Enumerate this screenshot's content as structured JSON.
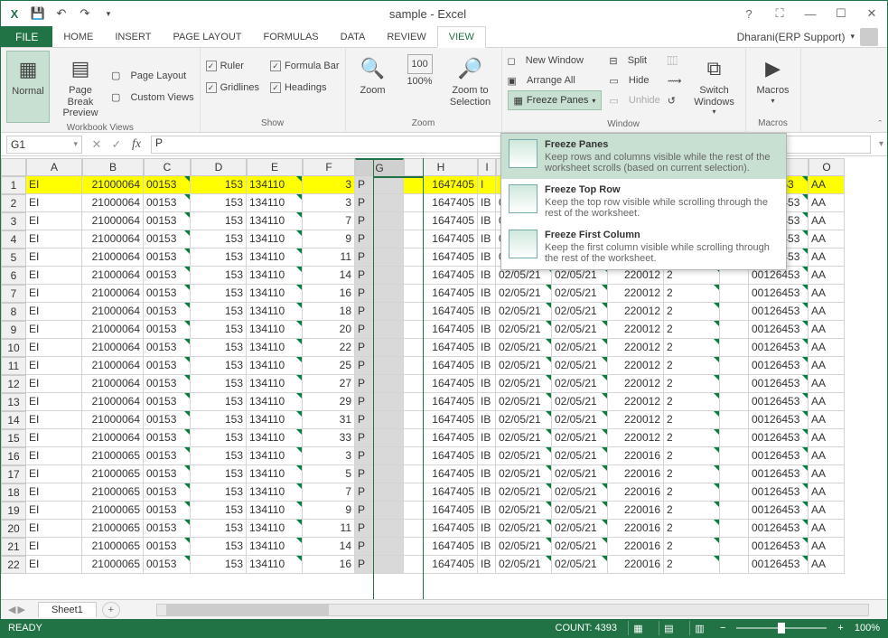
{
  "app": {
    "title": "sample - Excel"
  },
  "user": {
    "name": "Dharani(ERP Support)"
  },
  "tabs": {
    "file": "FILE",
    "items": [
      "HOME",
      "INSERT",
      "PAGE LAYOUT",
      "FORMULAS",
      "DATA",
      "REVIEW",
      "VIEW"
    ],
    "active": "VIEW"
  },
  "ribbon": {
    "workbook_views": {
      "label": "Workbook Views",
      "normal": "Normal",
      "page_break": "Page Break Preview",
      "page_layout": "Page Layout",
      "custom_views": "Custom Views"
    },
    "show": {
      "label": "Show",
      "ruler": "Ruler",
      "gridlines": "Gridlines",
      "formula_bar": "Formula Bar",
      "headings": "Headings"
    },
    "zoom": {
      "label": "Zoom",
      "zoom": "Zoom",
      "hundred": "100%",
      "to_selection": "Zoom to Selection"
    },
    "window": {
      "new_window": "New Window",
      "arrange_all": "Arrange All",
      "freeze_panes": "Freeze Panes",
      "split": "Split",
      "hide": "Hide",
      "unhide": "Unhide",
      "switch": "Switch Windows"
    },
    "macros": {
      "label": "Macros",
      "macros": "Macros"
    }
  },
  "freeze_menu": {
    "opt1": {
      "title": "Freeze Panes",
      "desc": "Keep rows and columns visible while the rest of the worksheet scrolls (based on current selection)."
    },
    "opt2": {
      "title": "Freeze Top Row",
      "desc": "Keep the top row visible while scrolling through the rest of the worksheet."
    },
    "opt3": {
      "title": "Freeze First Column",
      "desc": "Keep the first column visible while scrolling through the rest of the worksheet."
    }
  },
  "namebox": "G1",
  "formula": "P",
  "columns": [
    "A",
    "B",
    "C",
    "D",
    "E",
    "F",
    "G",
    "H",
    "I",
    "",
    "",
    "",
    "",
    "",
    "N",
    "O"
  ],
  "selected_col": "G",
  "rows": [
    {
      "r": 1,
      "hl": true,
      "a": "EI",
      "b": "21000064",
      "c": "00153",
      "d": "153",
      "e": "134110",
      "f": "3",
      "g": "P",
      "h": "1647405",
      "i": "I",
      "n": "0126453",
      "o": "AA"
    },
    {
      "r": 2,
      "a": "EI",
      "b": "21000064",
      "c": "00153",
      "d": "153",
      "e": "134110",
      "f": "3",
      "g": "P",
      "h": "1647405",
      "i": "IB",
      "j": "02/05/21",
      "k": "02/05/21",
      "l": "220012",
      "m": "2",
      "n": "00126453",
      "o": "AA"
    },
    {
      "r": 3,
      "a": "EI",
      "b": "21000064",
      "c": "00153",
      "d": "153",
      "e": "134110",
      "f": "7",
      "g": "P",
      "h": "1647405",
      "i": "IB",
      "j": "02/05/21",
      "k": "02/05/21",
      "l": "220012",
      "m": "2",
      "n": "00126453",
      "o": "AA"
    },
    {
      "r": 4,
      "a": "EI",
      "b": "21000064",
      "c": "00153",
      "d": "153",
      "e": "134110",
      "f": "9",
      "g": "P",
      "h": "1647405",
      "i": "IB",
      "j": "02/05/21",
      "k": "02/05/21",
      "l": "220012",
      "m": "2",
      "n": "00126453",
      "o": "AA"
    },
    {
      "r": 5,
      "a": "EI",
      "b": "21000064",
      "c": "00153",
      "d": "153",
      "e": "134110",
      "f": "11",
      "g": "P",
      "h": "1647405",
      "i": "IB",
      "j": "02/05/21",
      "k": "02/05/21",
      "l": "220012",
      "m": "2",
      "n": "00126453",
      "o": "AA"
    },
    {
      "r": 6,
      "a": "EI",
      "b": "21000064",
      "c": "00153",
      "d": "153",
      "e": "134110",
      "f": "14",
      "g": "P",
      "h": "1647405",
      "i": "IB",
      "j": "02/05/21",
      "k": "02/05/21",
      "l": "220012",
      "m": "2",
      "n": "00126453",
      "o": "AA"
    },
    {
      "r": 7,
      "a": "EI",
      "b": "21000064",
      "c": "00153",
      "d": "153",
      "e": "134110",
      "f": "16",
      "g": "P",
      "h": "1647405",
      "i": "IB",
      "j": "02/05/21",
      "k": "02/05/21",
      "l": "220012",
      "m": "2",
      "n": "00126453",
      "o": "AA"
    },
    {
      "r": 8,
      "a": "EI",
      "b": "21000064",
      "c": "00153",
      "d": "153",
      "e": "134110",
      "f": "18",
      "g": "P",
      "h": "1647405",
      "i": "IB",
      "j": "02/05/21",
      "k": "02/05/21",
      "l": "220012",
      "m": "2",
      "n": "00126453",
      "o": "AA"
    },
    {
      "r": 9,
      "a": "EI",
      "b": "21000064",
      "c": "00153",
      "d": "153",
      "e": "134110",
      "f": "20",
      "g": "P",
      "h": "1647405",
      "i": "IB",
      "j": "02/05/21",
      "k": "02/05/21",
      "l": "220012",
      "m": "2",
      "n": "00126453",
      "o": "AA"
    },
    {
      "r": 10,
      "a": "EI",
      "b": "21000064",
      "c": "00153",
      "d": "153",
      "e": "134110",
      "f": "22",
      "g": "P",
      "h": "1647405",
      "i": "IB",
      "j": "02/05/21",
      "k": "02/05/21",
      "l": "220012",
      "m": "2",
      "n": "00126453",
      "o": "AA"
    },
    {
      "r": 11,
      "a": "EI",
      "b": "21000064",
      "c": "00153",
      "d": "153",
      "e": "134110",
      "f": "25",
      "g": "P",
      "h": "1647405",
      "i": "IB",
      "j": "02/05/21",
      "k": "02/05/21",
      "l": "220012",
      "m": "2",
      "n": "00126453",
      "o": "AA"
    },
    {
      "r": 12,
      "a": "EI",
      "b": "21000064",
      "c": "00153",
      "d": "153",
      "e": "134110",
      "f": "27",
      "g": "P",
      "h": "1647405",
      "i": "IB",
      "j": "02/05/21",
      "k": "02/05/21",
      "l": "220012",
      "m": "2",
      "n": "00126453",
      "o": "AA"
    },
    {
      "r": 13,
      "a": "EI",
      "b": "21000064",
      "c": "00153",
      "d": "153",
      "e": "134110",
      "f": "29",
      "g": "P",
      "h": "1647405",
      "i": "IB",
      "j": "02/05/21",
      "k": "02/05/21",
      "l": "220012",
      "m": "2",
      "n": "00126453",
      "o": "AA"
    },
    {
      "r": 14,
      "a": "EI",
      "b": "21000064",
      "c": "00153",
      "d": "153",
      "e": "134110",
      "f": "31",
      "g": "P",
      "h": "1647405",
      "i": "IB",
      "j": "02/05/21",
      "k": "02/05/21",
      "l": "220012",
      "m": "2",
      "n": "00126453",
      "o": "AA"
    },
    {
      "r": 15,
      "a": "EI",
      "b": "21000064",
      "c": "00153",
      "d": "153",
      "e": "134110",
      "f": "33",
      "g": "P",
      "h": "1647405",
      "i": "IB",
      "j": "02/05/21",
      "k": "02/05/21",
      "l": "220012",
      "m": "2",
      "n": "00126453",
      "o": "AA"
    },
    {
      "r": 16,
      "a": "EI",
      "b": "21000065",
      "c": "00153",
      "d": "153",
      "e": "134110",
      "f": "3",
      "g": "P",
      "h": "1647405",
      "i": "IB",
      "j": "02/05/21",
      "k": "02/05/21",
      "l": "220016",
      "m": "2",
      "n": "00126453",
      "o": "AA"
    },
    {
      "r": 17,
      "a": "EI",
      "b": "21000065",
      "c": "00153",
      "d": "153",
      "e": "134110",
      "f": "5",
      "g": "P",
      "h": "1647405",
      "i": "IB",
      "j": "02/05/21",
      "k": "02/05/21",
      "l": "220016",
      "m": "2",
      "n": "00126453",
      "o": "AA"
    },
    {
      "r": 18,
      "a": "EI",
      "b": "21000065",
      "c": "00153",
      "d": "153",
      "e": "134110",
      "f": "7",
      "g": "P",
      "h": "1647405",
      "i": "IB",
      "j": "02/05/21",
      "k": "02/05/21",
      "l": "220016",
      "m": "2",
      "n": "00126453",
      "o": "AA"
    },
    {
      "r": 19,
      "a": "EI",
      "b": "21000065",
      "c": "00153",
      "d": "153",
      "e": "134110",
      "f": "9",
      "g": "P",
      "h": "1647405",
      "i": "IB",
      "j": "02/05/21",
      "k": "02/05/21",
      "l": "220016",
      "m": "2",
      "n": "00126453",
      "o": "AA"
    },
    {
      "r": 20,
      "a": "EI",
      "b": "21000065",
      "c": "00153",
      "d": "153",
      "e": "134110",
      "f": "11",
      "g": "P",
      "h": "1647405",
      "i": "IB",
      "j": "02/05/21",
      "k": "02/05/21",
      "l": "220016",
      "m": "2",
      "n": "00126453",
      "o": "AA"
    },
    {
      "r": 21,
      "a": "EI",
      "b": "21000065",
      "c": "00153",
      "d": "153",
      "e": "134110",
      "f": "14",
      "g": "P",
      "h": "1647405",
      "i": "IB",
      "j": "02/05/21",
      "k": "02/05/21",
      "l": "220016",
      "m": "2",
      "n": "00126453",
      "o": "AA"
    },
    {
      "r": 22,
      "a": "EI",
      "b": "21000065",
      "c": "00153",
      "d": "153",
      "e": "134110",
      "f": "16",
      "g": "P",
      "h": "1647405",
      "i": "IB",
      "j": "02/05/21",
      "k": "02/05/21",
      "l": "220016",
      "m": "2",
      "n": "00126453",
      "o": "AA"
    }
  ],
  "sheet": {
    "name": "Sheet1"
  },
  "status": {
    "ready": "READY",
    "count": "COUNT: 4393",
    "zoom": "100%"
  }
}
